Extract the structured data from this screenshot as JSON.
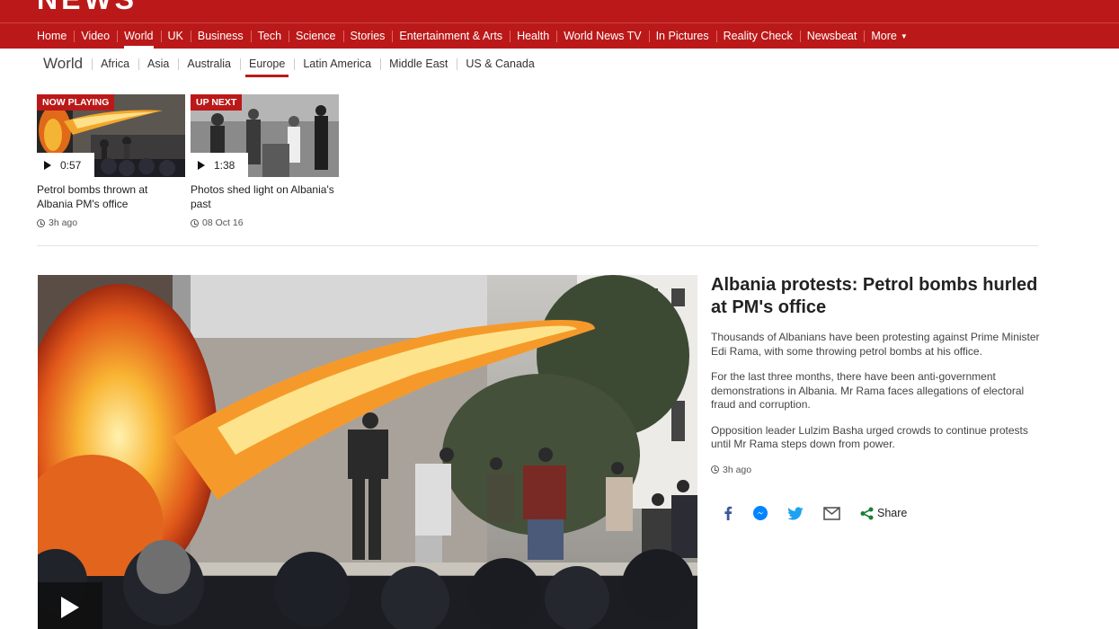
{
  "header": {
    "logo": "NEWS"
  },
  "nav": {
    "items": [
      "Home",
      "Video",
      "World",
      "UK",
      "Business",
      "Tech",
      "Science",
      "Stories",
      "Entertainment & Arts",
      "Health",
      "World News TV",
      "In Pictures",
      "Reality Check",
      "Newsbeat"
    ],
    "more": "More",
    "active": "World"
  },
  "subnav": {
    "section": "World",
    "items": [
      "Africa",
      "Asia",
      "Australia",
      "Europe",
      "Latin America",
      "Middle East",
      "US & Canada"
    ],
    "active": "Europe"
  },
  "videos": [
    {
      "tag": "NOW PLAYING",
      "duration": "0:57",
      "title": "Petrol bombs thrown at Albania PM's office",
      "time": "3h ago"
    },
    {
      "tag": "UP NEXT",
      "duration": "1:38",
      "title": "Photos shed light on Albania's past",
      "time": "08 Oct 16"
    }
  ],
  "article": {
    "headline": "Albania protests: Petrol bombs hurled at PM's office",
    "paragraphs": [
      "Thousands of Albanians have been protesting against Prime Minister Edi Rama, with some throwing petrol bombs at his office.",
      "For the last three months, there have been anti-government demonstrations in Albania. Mr Rama faces allegations of electoral fraud and corruption.",
      "Opposition leader Lulzim Basha urged crowds to continue protests until Mr Rama steps down from power."
    ],
    "time": "3h ago",
    "share_label": "Share"
  },
  "colors": {
    "brand_red": "#bb1919",
    "facebook": "#3b5998",
    "messenger": "#0084ff",
    "twitter": "#1da1f2",
    "share_green": "#1a7f37"
  }
}
